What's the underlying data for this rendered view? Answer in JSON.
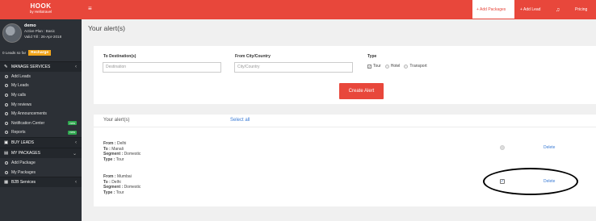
{
  "brand": {
    "name": "HOOK",
    "sub": "by Hellotravel"
  },
  "user": {
    "name": "demo",
    "plan": "Active Plan : Basic",
    "valid": "Valid Till : 26-Apr-2018",
    "leads_left": "0 Leads so far",
    "recharge_label": "Recharge"
  },
  "sidebar": {
    "manage_services": "MANAGE SERVICES",
    "items": [
      {
        "label": "Add Leads"
      },
      {
        "label": "My Leads"
      },
      {
        "label": "My calls"
      },
      {
        "label": "My reviews"
      },
      {
        "label": "My Announcements"
      },
      {
        "label": "Notification Center",
        "badge": "new"
      },
      {
        "label": "Reports",
        "badge": "new"
      }
    ],
    "buy_leads": "BUY LEADS",
    "my_packages": "MY PACKAGES",
    "package_items": [
      {
        "label": "Add Package"
      },
      {
        "label": "My Packages"
      }
    ],
    "b2b": "B2B Services"
  },
  "topbar": {
    "add_packages": "+ Add Packages",
    "add_lead": "+ Add Lead",
    "pricing": "Pricing"
  },
  "page": {
    "title": "Your alert(s)"
  },
  "form": {
    "to_label": "To Destination(s)",
    "to_placeholder": "Destination",
    "from_label": "From City/Country",
    "from_placeholder": "City/Country",
    "type_label": "Type",
    "types": [
      "Tour",
      "Hotel",
      "Transport"
    ],
    "create_label": "Create Alert"
  },
  "alerts": {
    "header": "Your alert(s)",
    "select_all": "Select all",
    "delete_label": "Delete",
    "rows": [
      {
        "from": "Delhi",
        "to": "Manali",
        "segment": "Domestic",
        "type": "Tour",
        "checked": false
      },
      {
        "from": "Mumbai",
        "to": "Delhi",
        "segment": "Domestic",
        "type": "Tour",
        "checked": true
      }
    ],
    "labels": {
      "from": "From :",
      "to": "To :",
      "segment": "Segment :",
      "type": "Type :"
    }
  },
  "colors": {
    "brand": "#e8473b",
    "sidebar": "#2c3036",
    "link": "#3a7bd5",
    "recharge": "#f1a51b",
    "badge": "#2fa84f"
  }
}
